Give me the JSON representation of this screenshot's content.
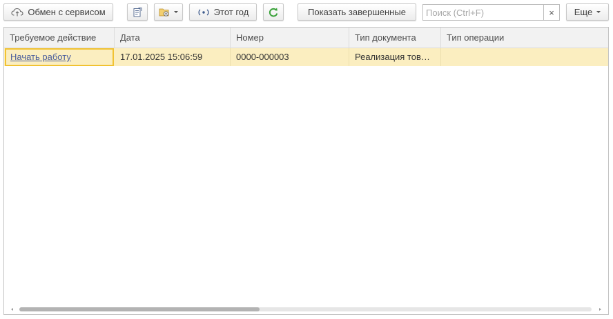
{
  "toolbar": {
    "exchange_label": "Обмен с сервисом",
    "period_label": "Этот год",
    "show_completed_label": "Показать завершенные",
    "more_label": "Еще"
  },
  "search": {
    "placeholder": "Поиск (Ctrl+F)",
    "value": "",
    "clear_glyph": "×"
  },
  "table": {
    "columns": [
      "Требуемое действие",
      "Дата",
      "Номер",
      "Тип документа",
      "Тип операции"
    ],
    "rows": [
      {
        "action": "Начать работу",
        "date": "17.01.2025 15:06:59",
        "number": "0000-000003",
        "doc_type": "Реализация тов…",
        "operation_type": ""
      }
    ],
    "selected_row_color": "#fbeec0",
    "active_cell_border_color": "#f1c232"
  },
  "scrollbar": {
    "horizontal_position_fraction": 0.42
  },
  "icons": {
    "exchange": "cloud-sync-icon",
    "report": "report-icon",
    "settings_folder": "folder-gear-icon",
    "period": "period-signal-icon",
    "refresh": "refresh-icon"
  },
  "colors": {
    "refresh_icon": "#3aa23a",
    "link": "#4a5d9b",
    "period_icon": "#3d5a8c"
  }
}
